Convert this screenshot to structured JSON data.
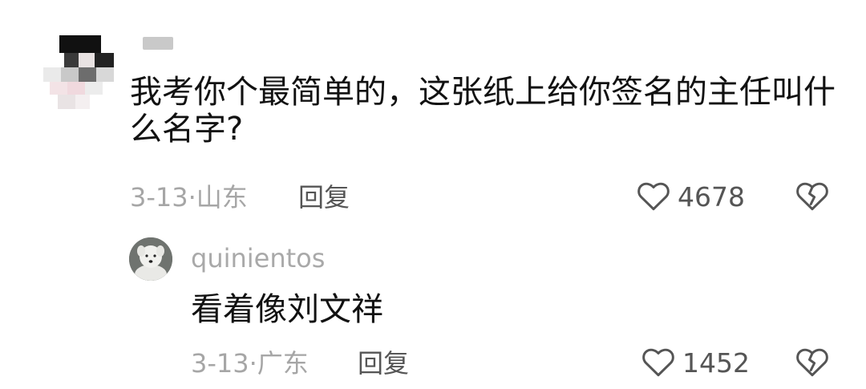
{
  "comment": {
    "author_name": "",
    "text_line1": "我考你个最简单的，这张纸上给你签名的主任叫什",
    "text_line2": "么名字?",
    "date": "3-13",
    "location": "山东",
    "reply_label": "回复",
    "like_count": "4678",
    "like_icon": "heart-outline-icon",
    "dislike_icon": "broken-heart-icon"
  },
  "reply": {
    "username": "quinientos",
    "text": "看着像刘文祥",
    "date": "3-13",
    "location": "广东",
    "reply_label": "回复",
    "like_count": "1452",
    "like_icon": "heart-outline-icon",
    "dislike_icon": "broken-heart-icon"
  }
}
